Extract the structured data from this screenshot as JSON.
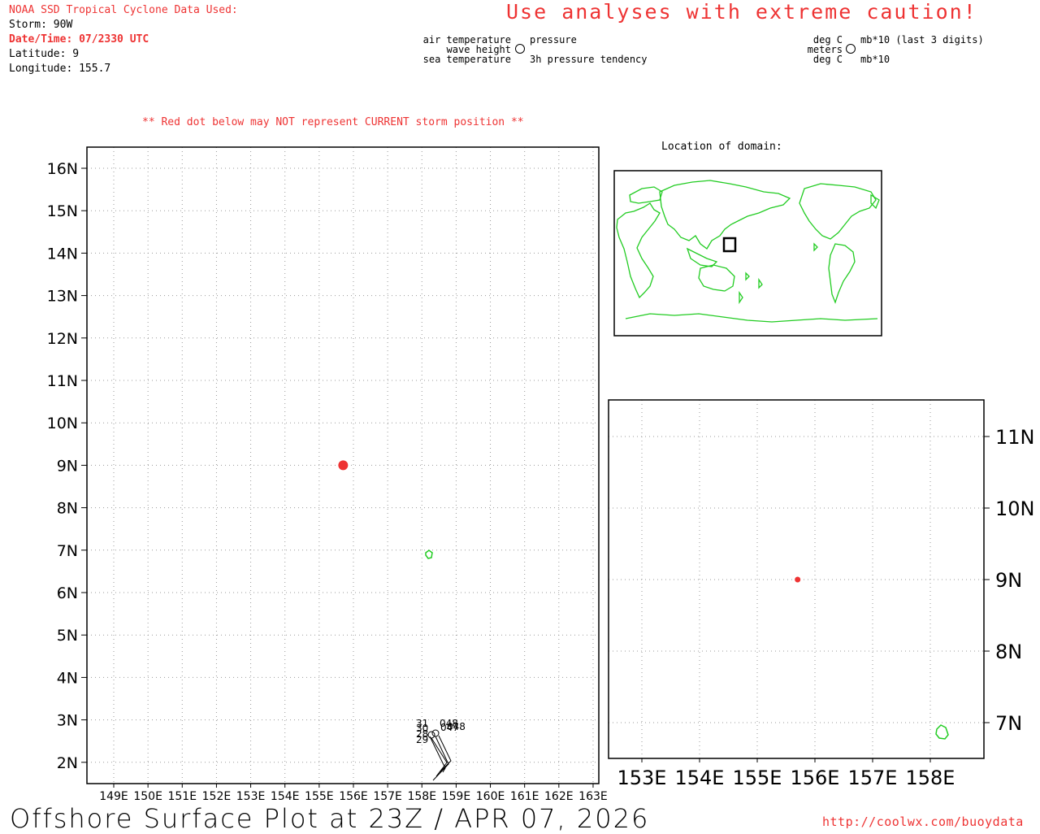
{
  "header": {
    "source_title": "NOAA SSD Tropical Cyclone Data Used:",
    "storm": "Storm: 90W",
    "datetime": "Date/Time: 07/2330 UTC",
    "latitude": "Latitude: 9",
    "longitude": "Longitude: 155.7",
    "caution": "Use analyses with extreme caution!",
    "red_dot_note": "** Red dot below may NOT represent CURRENT storm position **"
  },
  "station_legend": {
    "left": {
      "air_temperature": "air temperature",
      "wave_height": "wave height",
      "sea_temperature": "sea temperature",
      "pressure": "pressure",
      "pressure_tendency": "3h pressure tendency"
    },
    "right": {
      "deg_c_top": "deg C",
      "meters": "meters",
      "deg_c_bottom": "deg C",
      "mb_top": "mb*10 (last 3 digits)",
      "mb_bottom": "mb*10"
    }
  },
  "main_map": {
    "lat_labels": [
      "16N",
      "15N",
      "14N",
      "13N",
      "12N",
      "11N",
      "10N",
      "9N",
      "8N",
      "7N",
      "6N",
      "5N",
      "4N",
      "3N",
      "2N"
    ],
    "lon_labels": [
      "149E",
      "150E",
      "151E",
      "152E",
      "153E",
      "154E",
      "155E",
      "156E",
      "157E",
      "158E",
      "159E",
      "160E",
      "161E",
      "162E",
      "163E"
    ],
    "storm_position": {
      "lon": 155.7,
      "lat": 9
    },
    "buoy_labels": [
      "31",
      "048",
      "30",
      "047",
      "28",
      "048",
      "29"
    ]
  },
  "locator": {
    "title": "Location of domain:"
  },
  "zoom_map": {
    "lat_labels": [
      "11N",
      "10N",
      "9N",
      "8N",
      "7N"
    ],
    "lon_labels": [
      "153E",
      "154E",
      "155E",
      "156E",
      "157E",
      "158E"
    ]
  },
  "colors": {
    "storm_dot": "#ee3333",
    "land": "#22cc22",
    "grid": "#9a9a9a",
    "header_red": "#ee3333"
  },
  "footer": {
    "title": "Offshore Surface Plot at 23Z / APR 07, 2026",
    "url": "http://coolwx.com/buoydata"
  }
}
